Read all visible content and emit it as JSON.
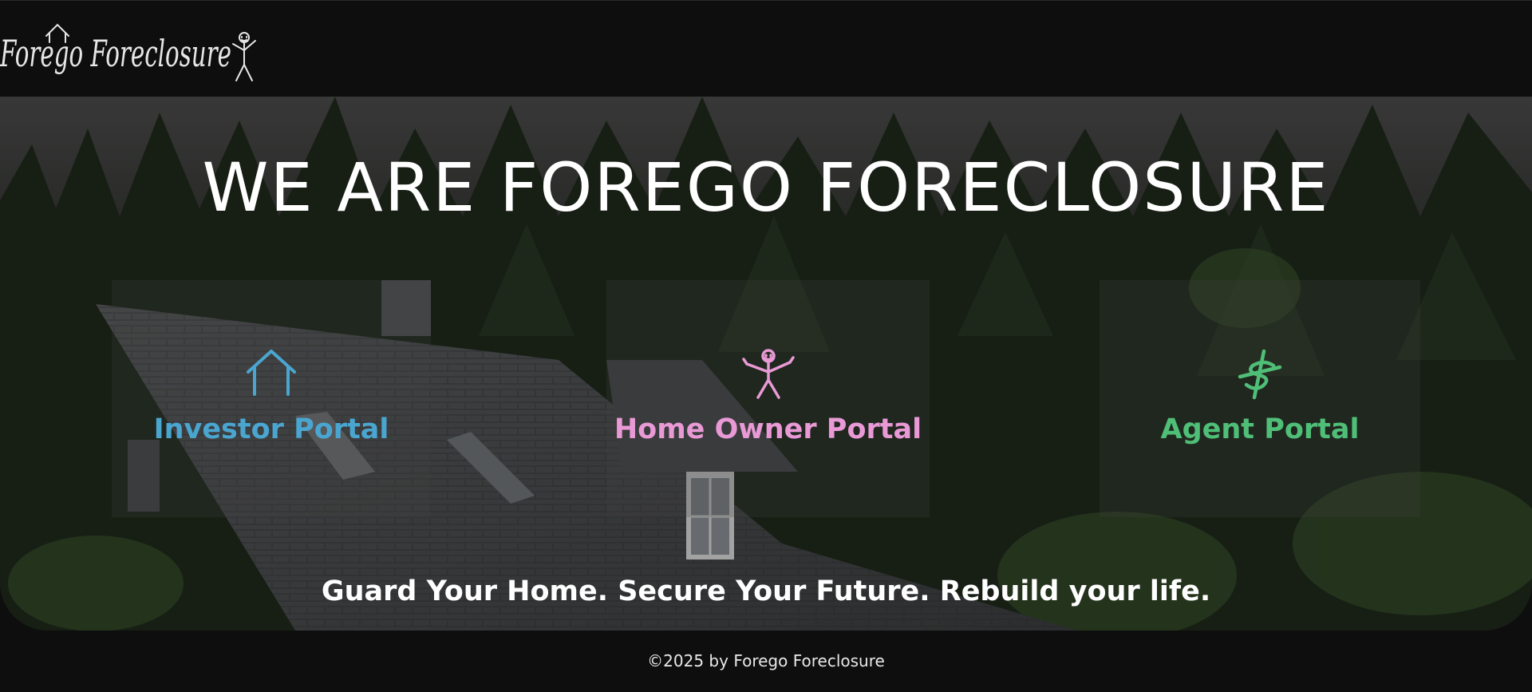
{
  "header": {
    "logo_text": "Forego Foreclosure"
  },
  "hero": {
    "title": "WE ARE FOREGO FORECLOSURE",
    "tagline": "Guard Your Home. Secure Your Future. Rebuild your life.",
    "portals": [
      {
        "label": "Investor Portal",
        "icon": "house-outline-icon",
        "color": "#4aa6d0"
      },
      {
        "label": "Home Owner Portal",
        "icon": "stick-figure-icon",
        "color": "#e99ad6"
      },
      {
        "label": "Agent Portal",
        "icon": "dollar-sign-icon",
        "color": "#4fbf78"
      }
    ]
  },
  "footer": {
    "copyright": "©2025 by Forego Foreclosure"
  }
}
